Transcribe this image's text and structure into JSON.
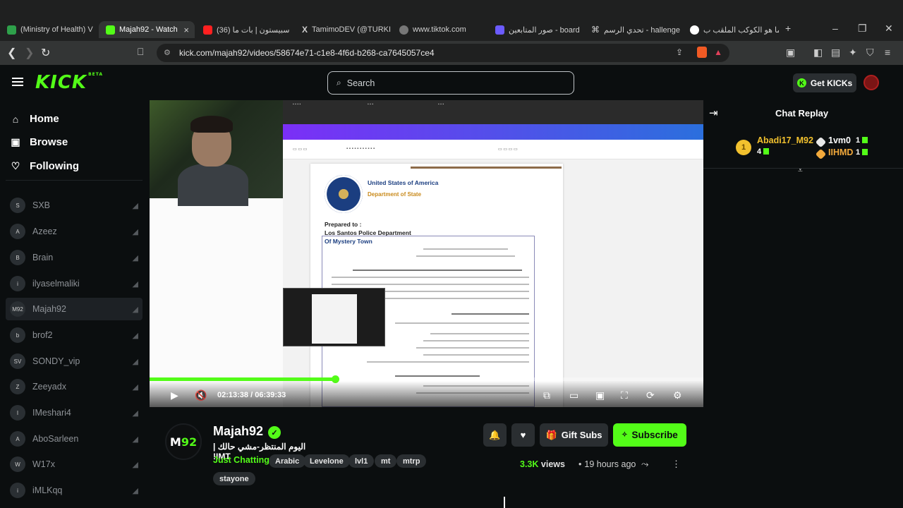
{
  "browser": {
    "tabs": [
      {
        "label": "(Ministry of Health) V",
        "fav": "#2ea04a"
      },
      {
        "label": "Majah92 - Watch",
        "fav": "#53fc18",
        "active": true
      },
      {
        "label": "(36) سبيستون | بات ما",
        "fav": "#ff2020"
      },
      {
        "label": "TamimoDEV (@TURKI",
        "fav": "#000000"
      },
      {
        "label": "www.tiktok.com",
        "fav": "#888888"
      },
      {
        "label": "صور المتابعين - board",
        "fav": "#6b5bff"
      },
      {
        "label": "تحدي الرسم - hallenge",
        "fav": "#ffffff"
      },
      {
        "label": "ما هو الكوكب الملقب ب",
        "fav": "#ffffff"
      }
    ],
    "url": "kick.com/majah92/videos/58674e71-c1e8-4f6d-b268-ca7645057ce4"
  },
  "kick": {
    "logo": "KICK",
    "logo_beta": "BETA",
    "search_placeholder": "Search",
    "get_kicks": "Get KICKs",
    "nav": [
      {
        "label": "Home",
        "icon": "home-icon"
      },
      {
        "label": "Browse",
        "icon": "browse-icon"
      },
      {
        "label": "Following",
        "icon": "heart-icon"
      }
    ],
    "channels": [
      {
        "name": "SXB",
        "avatar": "S"
      },
      {
        "name": "Azeez",
        "avatar": "A"
      },
      {
        "name": "Brain",
        "avatar": "B"
      },
      {
        "name": "ilyaselmaliki",
        "avatar": "i"
      },
      {
        "name": "Majah92",
        "avatar": "M92",
        "selected": true
      },
      {
        "name": "brof2",
        "avatar": "b"
      },
      {
        "name": "SONDY_vip",
        "avatar": "SV"
      },
      {
        "name": "Zeeyadx",
        "avatar": "Z"
      },
      {
        "name": "IMeshari4",
        "avatar": "I"
      },
      {
        "name": "AboSarleen",
        "avatar": "A"
      },
      {
        "name": "W17x",
        "avatar": "W"
      },
      {
        "name": "iMLKqq",
        "avatar": "i"
      }
    ]
  },
  "video": {
    "time_current": "02:13:38",
    "time_sep": "/",
    "time_total": "06:39:33",
    "progress": 0.335,
    "document": {
      "heading1": "United States of America",
      "heading2": "Department of State",
      "prepared_to": "Prepared to :",
      "recipient": "Los Santos Police Department",
      "recipient2": "Of Mystery Town"
    }
  },
  "chat": {
    "title": "Chat Replay",
    "leaderboard": [
      {
        "rank": "1",
        "name": "Abadi17_M92",
        "count": "4",
        "color": "#f2c12e"
      },
      {
        "name": "1vm0",
        "count": "1",
        "color": "#ffffff"
      },
      {
        "name": "IIHMD",
        "count": "1",
        "color": "#f2a93b"
      }
    ]
  },
  "channel": {
    "name": "Majah92",
    "title": "اليوم المنتظر-مشي حالك | IMT!",
    "category": "Just Chatting",
    "tags": [
      "Arabic",
      "Levelone",
      "lvl1",
      "mt",
      "mtrp",
      "stayone"
    ],
    "gift_subs": "Gift Subs",
    "subscribe": "Subscribe",
    "views_count": "3.3K",
    "views_label": "views",
    "time_ago": "19 hours ago"
  }
}
